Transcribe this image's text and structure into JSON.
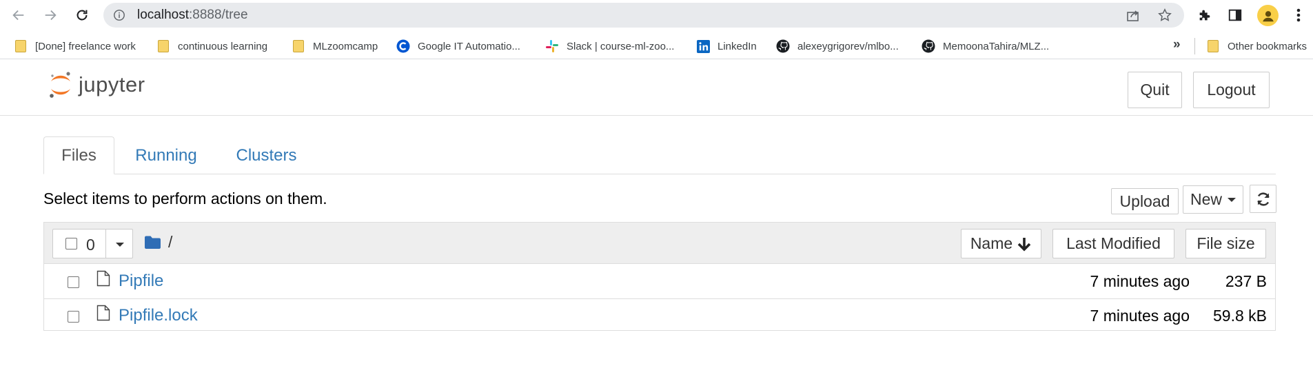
{
  "browser": {
    "url_host": "localhost",
    "url_path": ":8888/tree",
    "bookmarks": [
      {
        "label": "[Done] freelance work",
        "icon": "folder-icon"
      },
      {
        "label": "continuous learning",
        "icon": "folder-icon"
      },
      {
        "label": "MLzoomcamp",
        "icon": "folder-icon"
      },
      {
        "label": "Google IT Automatio...",
        "icon": "coursera-icon"
      },
      {
        "label": "Slack | course-ml-zoo...",
        "icon": "slack-icon"
      },
      {
        "label": "LinkedIn",
        "icon": "linkedin-icon"
      },
      {
        "label": "alexeygrigorev/mlbo...",
        "icon": "github-icon"
      },
      {
        "label": "MemoonaTahira/MLZ...",
        "icon": "github-icon"
      }
    ],
    "more_bookmarks": "»",
    "other_bookmarks": "Other bookmarks"
  },
  "header": {
    "logo_text": "jupyter",
    "quit_label": "Quit",
    "logout_label": "Logout"
  },
  "tabs": [
    {
      "label": "Files",
      "active": true
    },
    {
      "label": "Running",
      "active": false
    },
    {
      "label": "Clusters",
      "active": false
    }
  ],
  "toolbar": {
    "message": "Select items to perform actions on them.",
    "upload_label": "Upload",
    "new_label": "New"
  },
  "list": {
    "selected_count": "0",
    "breadcrumb": "/",
    "columns": {
      "name": "Name",
      "last_modified": "Last Modified",
      "file_size": "File size"
    },
    "files": [
      {
        "name": "Pipfile",
        "modified": "7 minutes ago",
        "size": "237 B"
      },
      {
        "name": "Pipfile.lock",
        "modified": "7 minutes ago",
        "size": "59.8 kB"
      }
    ]
  },
  "colors": {
    "link": "#337ab7",
    "jupyter_orange": "#f37726",
    "folder_blue": "#2f6db5"
  }
}
